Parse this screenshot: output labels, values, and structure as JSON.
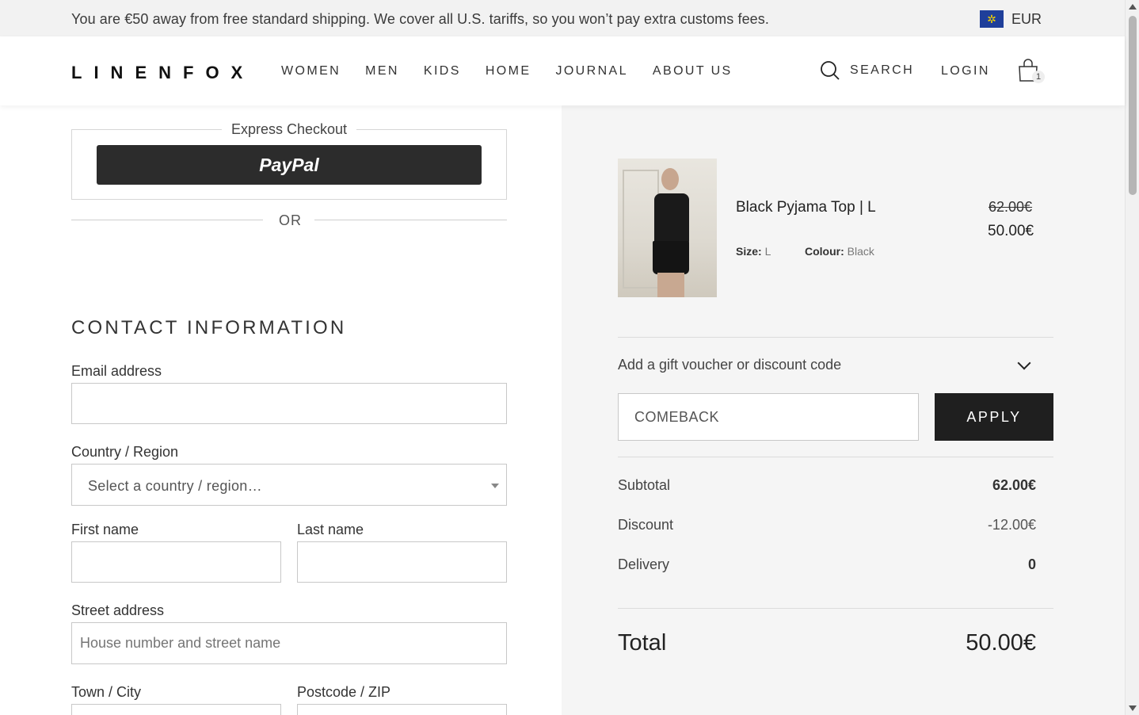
{
  "announcement": {
    "message": "You are €50 away from free standard shipping.  We cover all U.S. tariffs, so you won’t pay extra customs fees.",
    "currency": "EUR",
    "flag_icon": "eu-flag-icon"
  },
  "header": {
    "logo": "LINENFOX",
    "nav": [
      "WOMEN",
      "MEN",
      "KIDS",
      "HOME",
      "JOURNAL",
      "ABOUT US"
    ],
    "search_label": "SEARCH",
    "login_label": "LOGIN",
    "cart_count": "1"
  },
  "checkout": {
    "express_title": "Express Checkout",
    "paypal_label": "PayPal",
    "or_label": "OR",
    "contact_title": "CONTACT INFORMATION",
    "fields": {
      "email_label": "Email address",
      "country_label": "Country / Region",
      "country_value": "Select a country / region…",
      "first_name_label": "First name",
      "last_name_label": "Last name",
      "street_label": "Street address",
      "street_placeholder": "House number and street name",
      "town_label": "Town / City",
      "postcode_label": "Postcode / ZIP"
    }
  },
  "summary": {
    "item": {
      "name": "Black Pyjama Top | L",
      "old_price": "62.00€",
      "price": "50.00€",
      "size_label": "Size:",
      "size_value": "L",
      "colour_label": "Colour:",
      "colour_value": "Black"
    },
    "voucher_label": "Add a gift voucher or discount code",
    "voucher_code": "COMEBACK",
    "apply_label": "APPLY",
    "subtotal_label": "Subtotal",
    "subtotal_value": "62.00€",
    "discount_label": "Discount",
    "discount_value": "-12.00€",
    "delivery_label": "Delivery",
    "delivery_value": "0",
    "total_label": "Total",
    "total_value": "50.00€"
  },
  "colors": {
    "accent": "#1f1f1f",
    "panel": "#f5f5f5",
    "topbar": "#f2f2f2"
  }
}
